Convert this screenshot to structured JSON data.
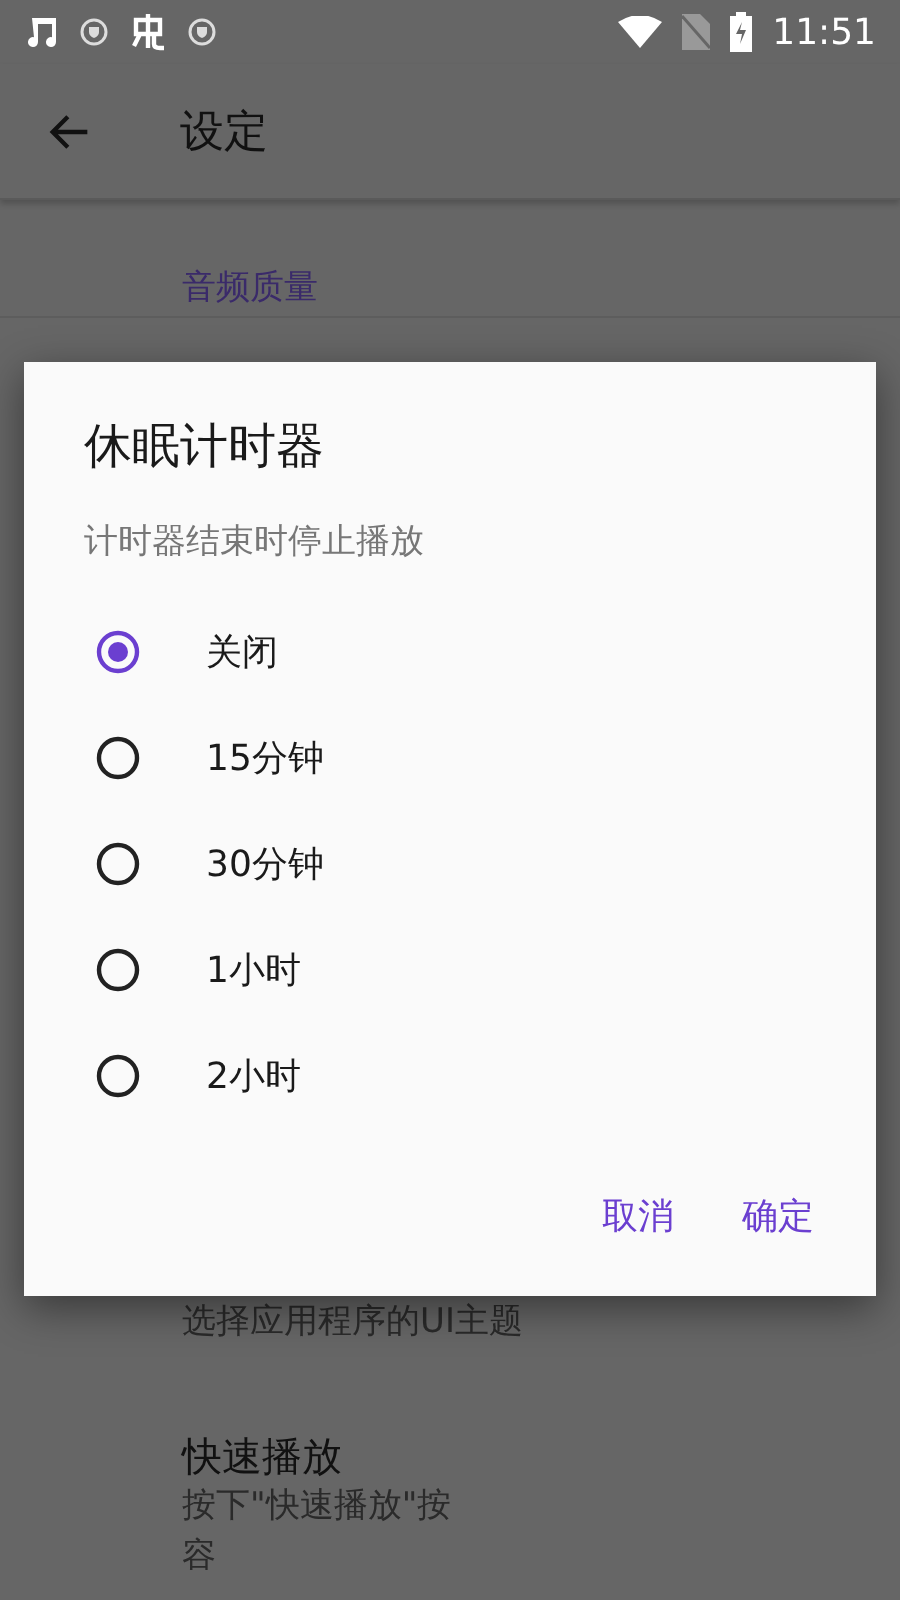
{
  "status_bar": {
    "time": "11:51"
  },
  "app_bar": {
    "title": "设定"
  },
  "settings": {
    "category": "音频质量",
    "theme_summary": "选择应用程序的UI主题",
    "quick_play": {
      "title": "快速播放",
      "description_lines": [
        "按下\"快速播放\"按",
        "容"
      ]
    }
  },
  "dialog": {
    "title": "休眠计时器",
    "message": "计时器结束时停止播放",
    "options": [
      {
        "label": "关闭",
        "selected": true
      },
      {
        "label": "15分钟",
        "selected": false
      },
      {
        "label": "30分钟",
        "selected": false
      },
      {
        "label": "1小时",
        "selected": false
      },
      {
        "label": "2小时",
        "selected": false
      }
    ],
    "buttons": [
      "取消",
      "确定"
    ]
  }
}
